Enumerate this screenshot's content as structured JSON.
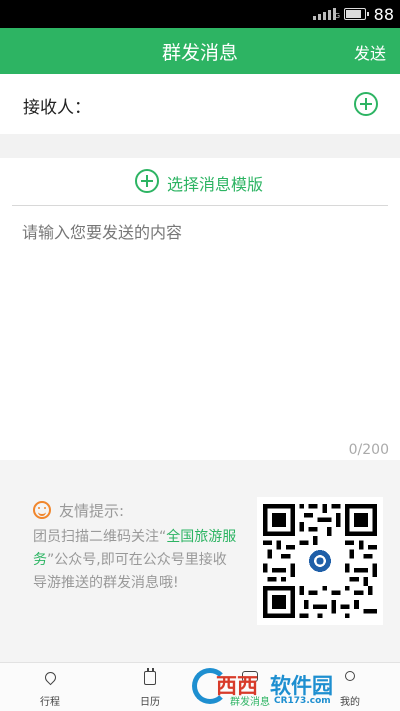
{
  "status_bar": {
    "network": "G",
    "battery_level": "88"
  },
  "header": {
    "title": "群发消息",
    "send_label": "发送"
  },
  "recipient": {
    "label": "接收人："
  },
  "template": {
    "label": "选择消息模版"
  },
  "message": {
    "placeholder": "请输入您要发送的内容",
    "counter": "0/200"
  },
  "tips": {
    "title": "友情提示:",
    "text_before": "团员扫描二维码关注“",
    "highlight": "全国旅游服务",
    "text_after": "”公众号,即可在公众号里接收导游推送的群发消息哦!"
  },
  "tabs": [
    {
      "label": "行程",
      "icon": "location-pin-icon"
    },
    {
      "label": "日历",
      "icon": "calendar-icon"
    },
    {
      "label": "群发消息",
      "icon": "chat-icon",
      "active": true
    },
    {
      "label": "我的",
      "icon": "person-icon"
    }
  ],
  "watermark": {
    "brand_a": "西西",
    "brand_b": "软件园",
    "url": "CR173.com"
  },
  "colors": {
    "accent": "#2db463",
    "tip_icon": "#f0862c",
    "watermark_blue": "#1e8fd0",
    "watermark_red": "#d83b2a"
  }
}
